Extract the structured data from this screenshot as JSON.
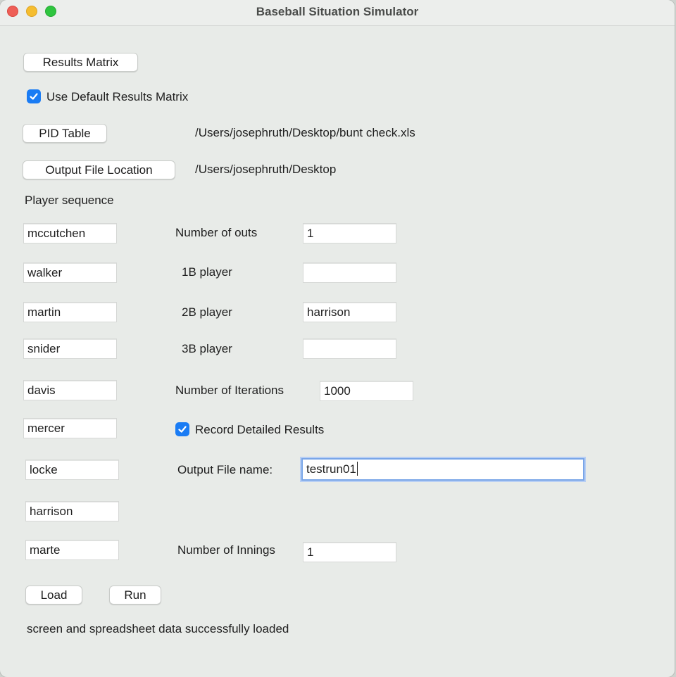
{
  "window": {
    "title": "Baseball Situation Simulator"
  },
  "buttons": {
    "results_matrix": "Results Matrix",
    "pid_table": "PID Table",
    "output_file_location": "Output File Location",
    "load": "Load",
    "run": "Run"
  },
  "checkboxes": {
    "use_default": {
      "label": "Use Default Results Matrix",
      "checked": true
    },
    "record_detailed": {
      "label": "Record Detailed Results",
      "checked": true
    }
  },
  "paths": {
    "pid_table": "/Users/josephruth/Desktop/bunt check.xls",
    "output_location": "/Users/josephruth/Desktop"
  },
  "player_sequence": {
    "label": "Player sequence",
    "players": [
      "mccutchen",
      "walker",
      "martin",
      "snider",
      "davis",
      "mercer",
      "locke",
      "harrison",
      "marte"
    ]
  },
  "settings": {
    "outs_label": "Number of outs",
    "outs_value": "1",
    "first_label": "1B player",
    "first_value": "",
    "second_label": "2B player",
    "second_value": "harrison",
    "third_label": "3B player",
    "third_value": "",
    "iterations_label": "Number of Iterations",
    "iterations_value": "1000",
    "output_name_label": "Output File name:",
    "output_name_value": "testrun01",
    "innings_label": "Number of Innings",
    "innings_value": "1"
  },
  "status": {
    "message": "screen and spreadsheet data successfully loaded"
  }
}
